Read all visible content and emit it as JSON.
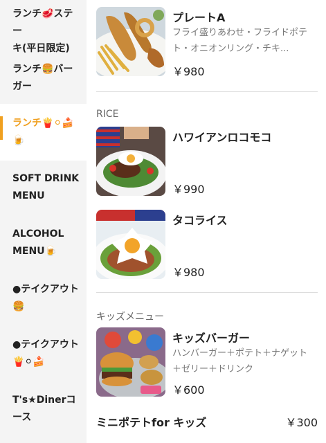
{
  "sidebar": {
    "items": [
      {
        "label_1": "ランチ🥩ステー",
        "label_2": "キ(平日限定)"
      },
      {
        "label_1": "ランチ🍔バー",
        "label_2": "ガー"
      },
      {
        "label_1": "ランチ🍟⚪🍰",
        "label_2": "🍺"
      },
      {
        "label_1": "SOFT DRINK",
        "label_2": "MENU"
      },
      {
        "label_1": "ALCOHOL",
        "label_2": "MENU🍺"
      },
      {
        "label_1": "●テイクアウト",
        "label_2": "🍔"
      },
      {
        "label_1": "●テイクアウト",
        "label_2": "🍟⚪🍰"
      },
      {
        "label_1": "T's★Dinerコ",
        "label_2": "ース"
      }
    ],
    "active_index": 2
  },
  "main": {
    "plate_a": {
      "name": "プレートA",
      "desc": "フライ盛りあわせ・フライドポテト・オニオンリング・チキ...",
      "price": "￥980"
    },
    "rice_section": "RICE",
    "loco_moco": {
      "name": "ハワイアンロコモコ",
      "price": "￥990"
    },
    "taco_rice": {
      "name": "タコライス",
      "price": "￥980"
    },
    "kids_section": "キッズメニュー",
    "kids_burger": {
      "name": "キッズバーガー",
      "desc": "ハンバーガー＋ポテト＋ナゲット＋ゼリー＋ドリンク",
      "price": "￥600"
    },
    "mini_potato": {
      "name": "ミニポテトfor キッズ",
      "price": "￥300"
    }
  },
  "colors": {
    "accent": "#f0a020",
    "sidebar_bg": "#f4f4f4"
  }
}
